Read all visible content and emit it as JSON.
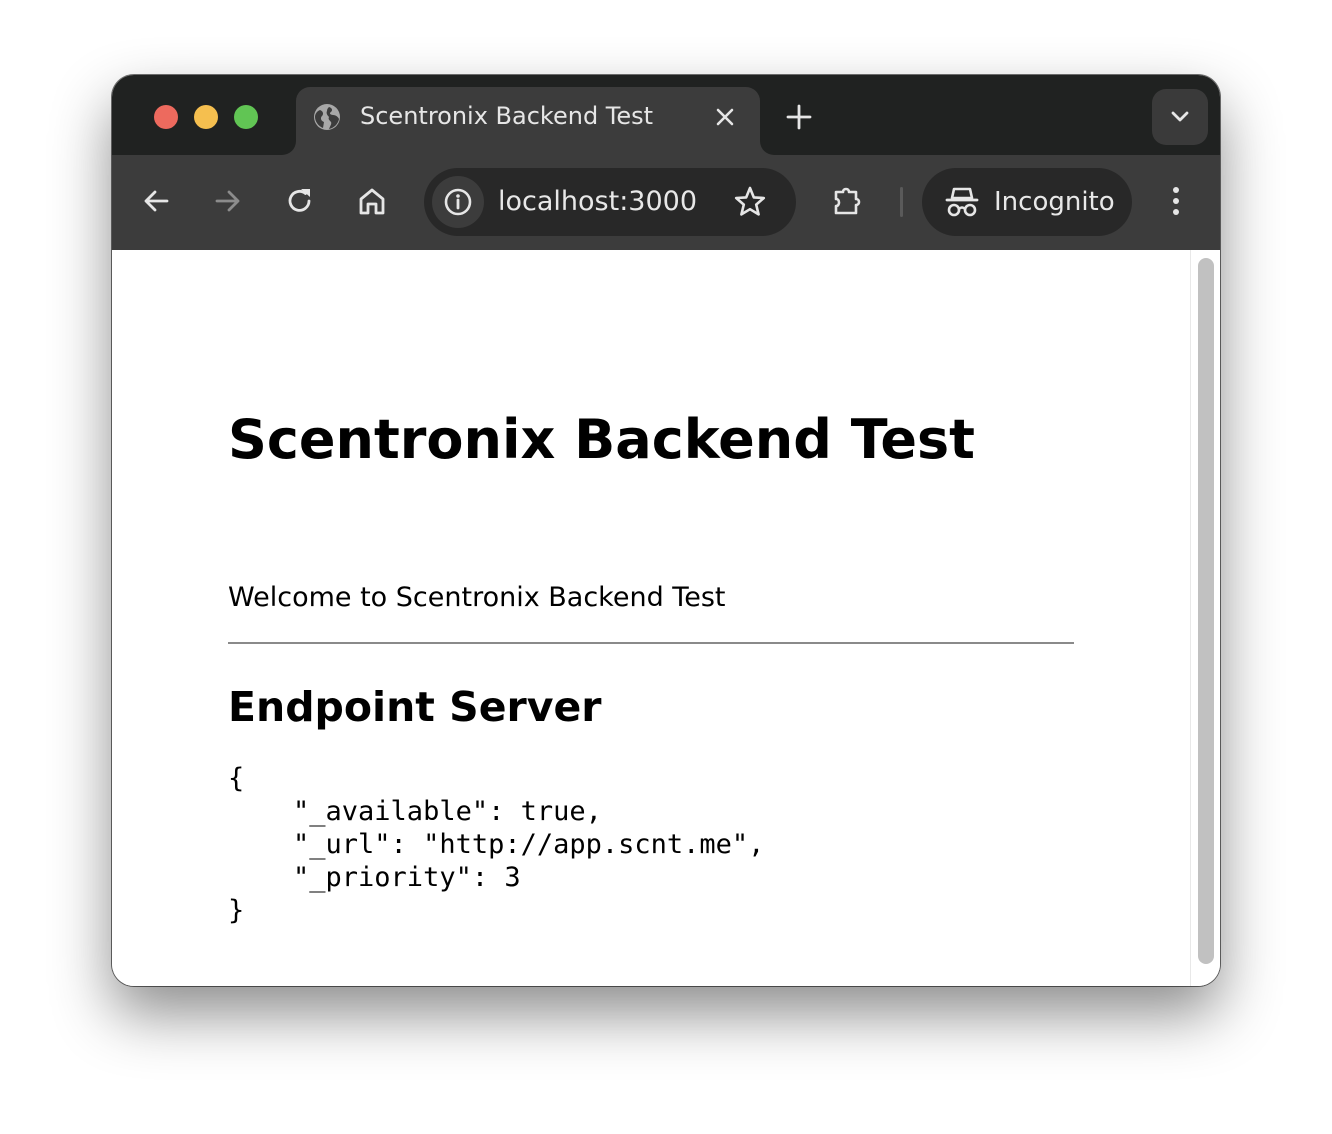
{
  "browser": {
    "tab": {
      "title": "Scentronix Backend Test",
      "favicon": "globe-icon"
    },
    "address_bar": {
      "url": "localhost:3000"
    },
    "profile": {
      "label": "Incognito"
    },
    "colors": {
      "frame": "#202221",
      "toolbar": "#3c3c3c",
      "omnibox": "#282828",
      "close_dot": "#ed6a5e",
      "minimize_dot": "#f5bf4f",
      "zoom_dot": "#61c554"
    }
  },
  "page": {
    "title": "Scentronix Backend Test",
    "welcome_text": "Welcome to Scentronix Backend Test",
    "section_title": "Endpoint Server",
    "json_lines": [
      "{",
      "    \"_available\": true,",
      "    \"_url\": \"http://app.scnt.me\",",
      "    \"_priority\": 3",
      "}"
    ]
  }
}
